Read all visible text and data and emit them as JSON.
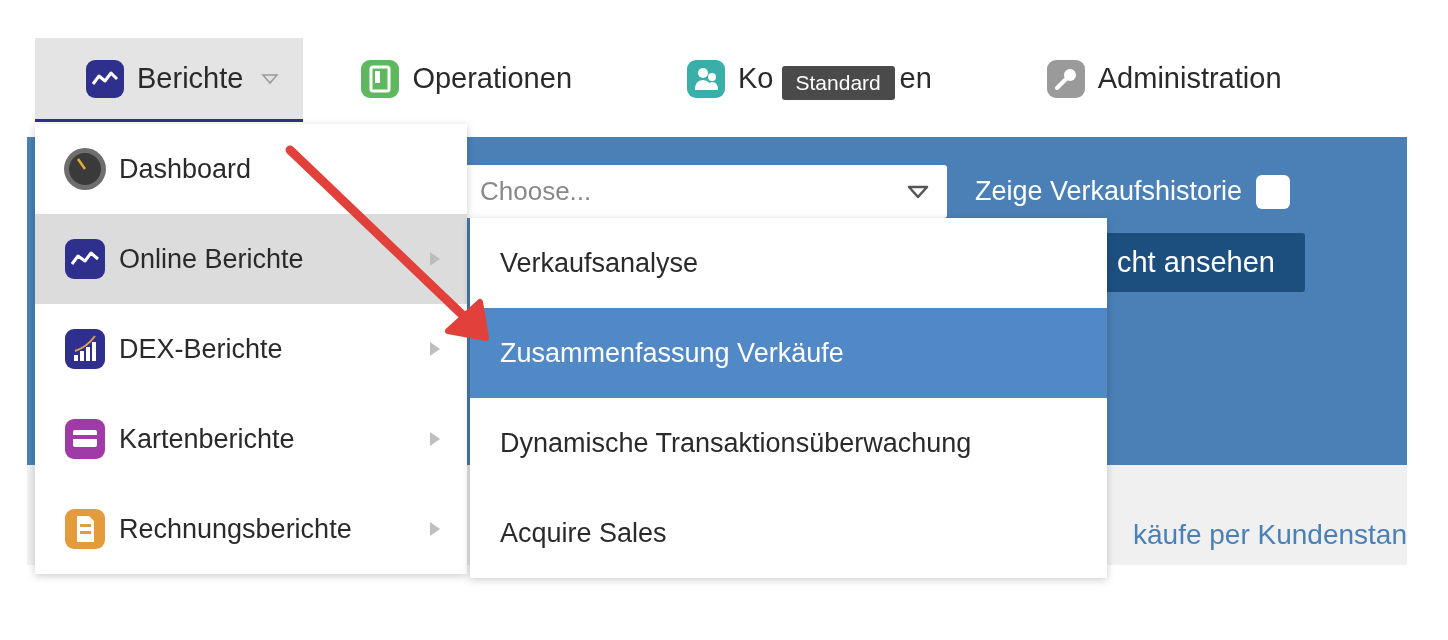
{
  "nav_tabs": [
    {
      "label": "Berichte",
      "selected": true,
      "has_caret": true
    },
    {
      "label": "Operationen",
      "selected": false,
      "has_caret": false
    },
    {
      "label_parts": [
        "Ko",
        "en"
      ],
      "selected": false,
      "has_caret": false
    },
    {
      "label": "Administration",
      "selected": false,
      "has_caret": false
    }
  ],
  "tooltip": {
    "text": "Standard"
  },
  "filter_panel": {
    "select": {
      "placeholder": "Choose..."
    },
    "checkbox": {
      "label": "Zeige Verkaufshistorie",
      "checked": false
    },
    "button": "cht ansehen"
  },
  "link": "käufe per Kundenstan",
  "menu": {
    "items": [
      {
        "label": "Dashboard",
        "selected": false,
        "has_submenu": false
      },
      {
        "label": "Online Berichte",
        "selected": true,
        "has_submenu": true
      },
      {
        "label": "DEX-Berichte",
        "selected": false,
        "has_submenu": true
      },
      {
        "label": "Kartenberichte",
        "selected": false,
        "has_submenu": true
      },
      {
        "label": "Rechnungsberichte",
        "selected": false,
        "has_submenu": true
      }
    ]
  },
  "submenu": {
    "items": [
      {
        "label": "Verkaufsanalyse",
        "selected": false
      },
      {
        "label": "Zusammenfassung Verkäufe",
        "selected": true
      },
      {
        "label": "Dynamische Transaktionsüberwachung",
        "selected": false
      },
      {
        "label": "Acquire Sales",
        "selected": false
      }
    ]
  }
}
